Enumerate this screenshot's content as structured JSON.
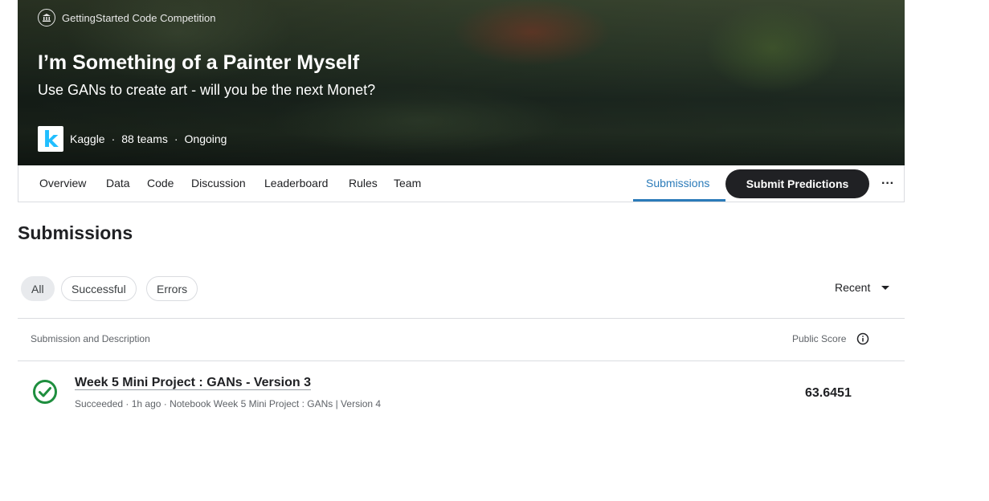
{
  "banner": {
    "competition_type": "GettingStarted Code Competition",
    "title": "I’m Something of a Painter Myself",
    "subtitle": "Use GANs to create art - will you be the next Monet?",
    "logo_letter": "k",
    "host": "Kaggle",
    "teams": "88 teams",
    "status": "Ongoing",
    "separator": "·"
  },
  "tabs": {
    "overview": "Overview",
    "data": "Data",
    "code": "Code",
    "discussion": "Discussion",
    "leaderboard": "Leaderboard",
    "rules": "Rules",
    "team": "Team",
    "submissions": "Submissions"
  },
  "actions": {
    "submit_label": "Submit Predictions",
    "more_label": "···"
  },
  "page": {
    "section_title": "Submissions"
  },
  "filters": {
    "all": "All",
    "successful": "Successful",
    "errors": "Errors",
    "active": "All"
  },
  "sort": {
    "label": "Recent"
  },
  "table": {
    "col_submission": "Submission and Description",
    "col_score": "Public Score",
    "rows": [
      {
        "title": "Week 5 Mini Project : GANs - Version 3",
        "meta": "Succeeded · 1h ago · Notebook Week 5 Mini Project : GANs | Version 4",
        "score": "63.6451",
        "status": "succeeded"
      }
    ]
  },
  "colors": {
    "accent": "#2b7bb9",
    "success": "#1e8e3e",
    "button_dark": "#202124",
    "kaggle_blue": "#20beff"
  },
  "icons": [
    "bank-icon",
    "kaggle-logo",
    "more-horizontal-icon",
    "dropdown-caret-icon",
    "info-icon",
    "check-circle-icon"
  ]
}
